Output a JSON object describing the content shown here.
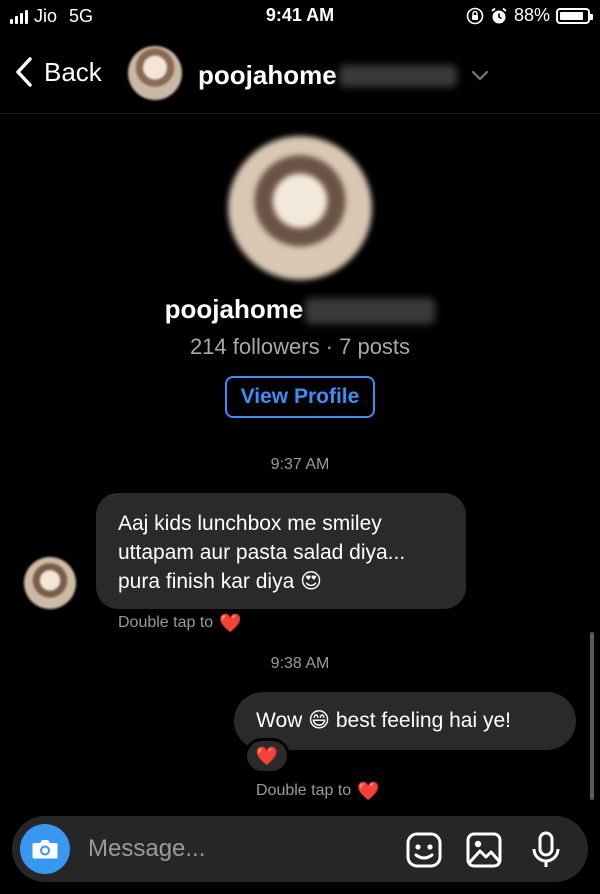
{
  "status_bar": {
    "carrier": "Jio",
    "network": "5G",
    "time": "9:41 AM",
    "battery_percent": "88%",
    "battery_level": 0.88
  },
  "header": {
    "back_label": "Back",
    "username": "poojahome"
  },
  "profile": {
    "name": "poojahome",
    "stats": "214 followers · 7 posts",
    "view_profile_label": "View Profile"
  },
  "messages": [
    {
      "timestamp": "9:37 AM",
      "direction": "incoming",
      "lines": [
        "Aaj kids lunchbox me smiley",
        "uttapam aur pasta salad diya...",
        "pura finish kar diya 😍"
      ],
      "hint": "Double tap to"
    },
    {
      "timestamp": "9:38 AM",
      "direction": "outgoing",
      "text": "Wow 😄 best feeling hai ye!",
      "reaction": "❤️",
      "hint": "Double tap to"
    }
  ],
  "hint_heart": "❤️",
  "composer": {
    "placeholder": "Message..."
  },
  "colors": {
    "accent": "#3d8df5",
    "camera": "#3897f0",
    "bubble": "#2a2a2a",
    "heart": "#ff2d3c"
  }
}
